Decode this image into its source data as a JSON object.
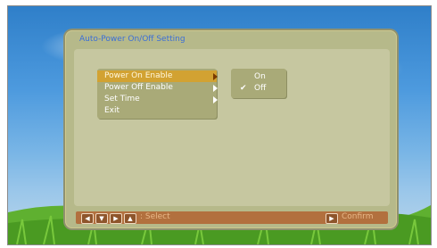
{
  "panel": {
    "title": "Auto-Power On/Off Setting"
  },
  "menu": {
    "items": [
      {
        "label": "Power On Enable",
        "has_submenu": true,
        "selected": true
      },
      {
        "label": "Power Off Enable",
        "has_submenu": true,
        "selected": false
      },
      {
        "label": "Set Time",
        "has_submenu": true,
        "selected": false
      },
      {
        "label": "Exit",
        "has_submenu": false,
        "selected": false
      }
    ]
  },
  "submenu": {
    "options": [
      {
        "label": "On",
        "checked": false
      },
      {
        "label": "Off",
        "checked": true,
        "check_glyph": "✔"
      }
    ]
  },
  "footer": {
    "nav_keys": [
      "◀",
      "▼",
      "▶",
      "▲"
    ],
    "select_label": ": Select",
    "confirm_key": "▶",
    "confirm_label": "Confirm"
  },
  "colors": {
    "title": "#3b6fd6",
    "selected_item": "#d2a232",
    "panel": "#c6c7a0",
    "footer": "#b2703e"
  }
}
